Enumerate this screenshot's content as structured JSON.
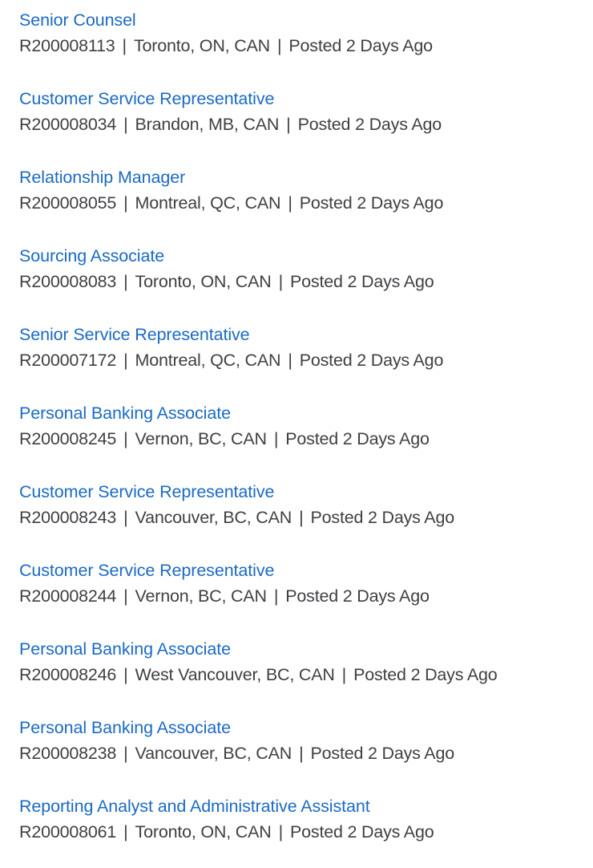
{
  "page": {
    "background_color": "#ffffff",
    "link_color": "#1a6ac4",
    "text_color": "#3f4044",
    "separator": "|"
  },
  "jobs": [
    {
      "title": "Senior Counsel",
      "req_id": "R200008113",
      "location": "Toronto, ON, CAN",
      "posted": "Posted 2 Days Ago"
    },
    {
      "title": "Customer Service Representative",
      "req_id": "R200008034",
      "location": "Brandon, MB, CAN",
      "posted": "Posted 2 Days Ago"
    },
    {
      "title": "Relationship Manager",
      "req_id": "R200008055",
      "location": "Montreal, QC, CAN",
      "posted": "Posted 2 Days Ago"
    },
    {
      "title": "Sourcing Associate",
      "req_id": "R200008083",
      "location": "Toronto, ON, CAN",
      "posted": "Posted 2 Days Ago"
    },
    {
      "title": "Senior Service Representative",
      "req_id": "R200007172",
      "location": "Montreal, QC, CAN",
      "posted": "Posted 2 Days Ago"
    },
    {
      "title": "Personal Banking Associate",
      "req_id": "R200008245",
      "location": "Vernon, BC, CAN",
      "posted": "Posted 2 Days Ago"
    },
    {
      "title": "Customer Service Representative",
      "req_id": "R200008243",
      "location": "Vancouver, BC, CAN",
      "posted": "Posted 2 Days Ago"
    },
    {
      "title": "Customer Service Representative",
      "req_id": "R200008244",
      "location": "Vernon, BC, CAN",
      "posted": "Posted 2 Days Ago"
    },
    {
      "title": "Personal Banking Associate",
      "req_id": "R200008246",
      "location": "West Vancouver, BC, CAN",
      "posted": "Posted 2 Days Ago"
    },
    {
      "title": "Personal Banking Associate",
      "req_id": "R200008238",
      "location": "Vancouver, BC, CAN",
      "posted": "Posted 2 Days Ago"
    },
    {
      "title": "Reporting Analyst and Administrative Assistant",
      "req_id": "R200008061",
      "location": "Toronto, ON, CAN",
      "posted": "Posted 2 Days Ago"
    }
  ]
}
